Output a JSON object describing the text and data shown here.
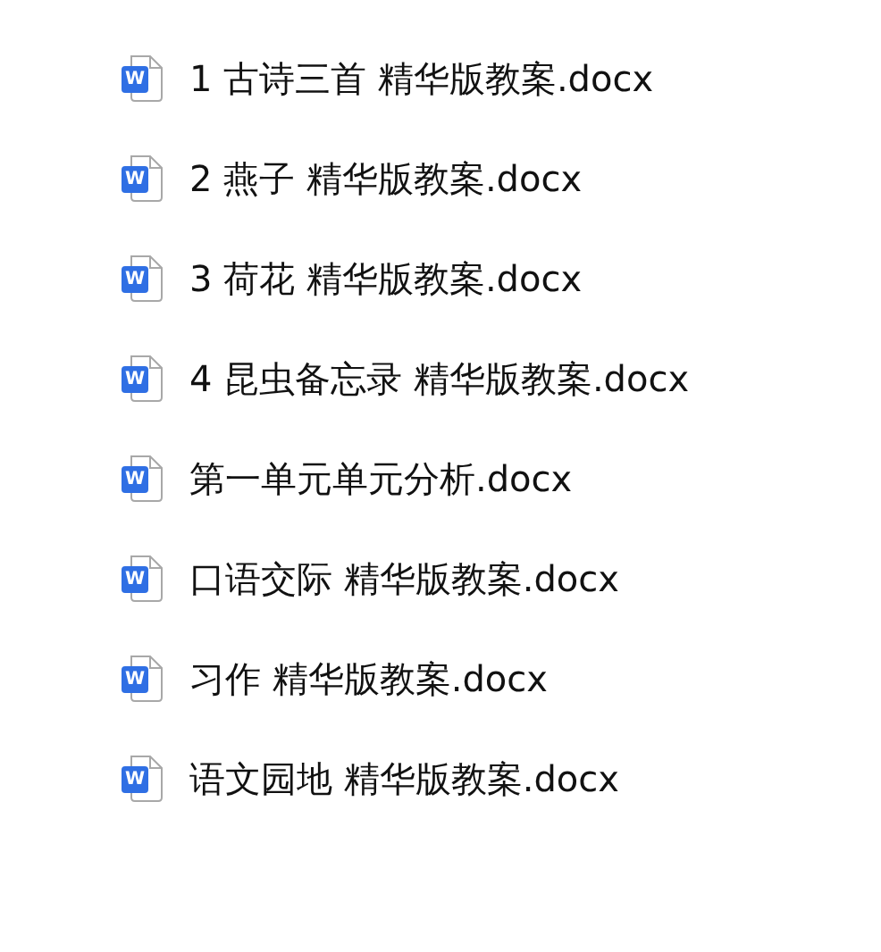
{
  "files": [
    {
      "icon_letter": "W",
      "name": "1 古诗三首 精华版教案.docx"
    },
    {
      "icon_letter": "W",
      "name": "2 燕子 精华版教案.docx"
    },
    {
      "icon_letter": "W",
      "name": "3 荷花 精华版教案.docx"
    },
    {
      "icon_letter": "W",
      "name": "4 昆虫备忘录 精华版教案.docx"
    },
    {
      "icon_letter": "W",
      "name": "第一单元单元分析.docx"
    },
    {
      "icon_letter": "W",
      "name": "口语交际 精华版教案.docx"
    },
    {
      "icon_letter": "W",
      "name": "习作 精华版教案.docx"
    },
    {
      "icon_letter": "W",
      "name": "语文园地 精华版教案.docx"
    }
  ]
}
